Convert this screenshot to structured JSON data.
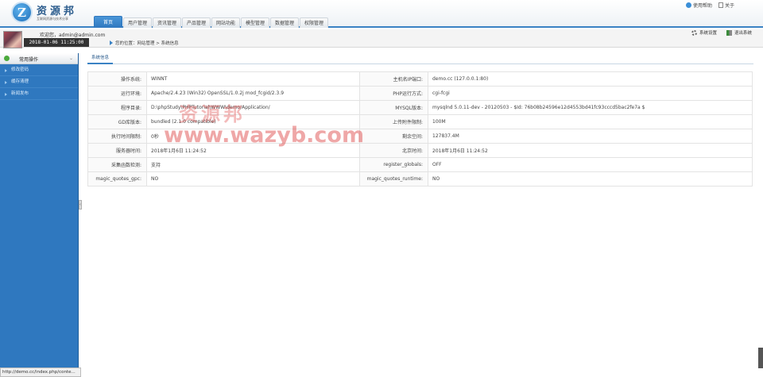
{
  "brand": {
    "logo_letter": "Z",
    "name": "资源邦",
    "slogan": "互联网资源与技术分享"
  },
  "nav": {
    "tabs": [
      "首页",
      "用户管理",
      "资讯管理",
      "产品管理",
      "网站功能",
      "模型管理",
      "数据管理",
      "权限管理"
    ],
    "active_index": 0
  },
  "top_links": {
    "help": "使用帮助",
    "about": "关于"
  },
  "user": {
    "welcome": "欢迎您，admin@admin.com",
    "datetime": "2018-01-06 11:25:00"
  },
  "breadcrumb": "您的位置：网站管理 > 系统信息",
  "actions": {
    "settings": "系统设置",
    "logout": "退出系统"
  },
  "sidebar": {
    "header": "常用操作",
    "items": [
      "修改密码",
      "缓存清理",
      "新闻发布"
    ]
  },
  "content": {
    "tab": "系统信息",
    "rows": [
      [
        "操作系统:",
        "WINNT",
        "主机名IP端口:",
        "demo.cc (127.0.0.1:80)"
      ],
      [
        "运行环境:",
        "Apache/2.4.23 (Win32) OpenSSL/1.0.2j mod_fcgid/2.3.9",
        "PHP运行方式:",
        "cgi-fcgi"
      ],
      [
        "程序目录:",
        "D:\\phpStudy\\PHPTutorial\\WWW\\demo/Application/",
        "MYSQL版本:",
        "mysqlnd 5.0.11-dev - 20120503 - $Id: 76b08b24596e12d4553bd41fc93cccd5bac2fe7a $"
      ],
      [
        "GD库版本:",
        "bundled (2.1.0 compatible)",
        "上传附件限制:",
        "100M"
      ],
      [
        "执行时间限制:",
        "0秒",
        "剩余空间:",
        "127837.4M"
      ],
      [
        "服务器时间:",
        "2018年1月6日 11:24:52",
        "北京时间:",
        "2018年1月6日 11:24:52"
      ],
      [
        "采集函数检测:",
        "支持",
        "register_globals:",
        "OFF"
      ],
      [
        "magic_quotes_gpc:",
        "NO",
        "magic_quotes_runtime:",
        "NO"
      ]
    ]
  },
  "watermark": {
    "cn": "资源邦",
    "url": "www.wazyb.com"
  },
  "statusbar": "http://demo.cc/index.php/conte..."
}
